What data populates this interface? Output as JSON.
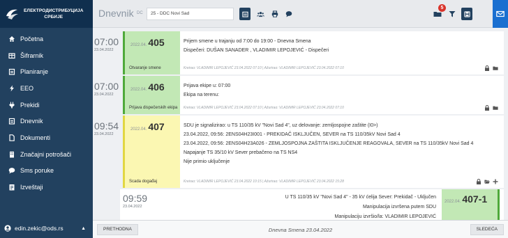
{
  "brand": {
    "line1": "ЕЛЕКТРОДИСТРИБУЦИЈА",
    "line2": "СРБИЈЕ"
  },
  "sidebar": {
    "items": [
      {
        "label": "Početna",
        "icon": "home-icon"
      },
      {
        "label": "Šifrarnik",
        "icon": "table-icon"
      },
      {
        "label": "Planiranje",
        "icon": "calendar-icon"
      },
      {
        "label": "EEO",
        "icon": "bolt-icon"
      },
      {
        "label": "Prekidi",
        "icon": "plug-icon"
      },
      {
        "label": "Dnevnik",
        "icon": "calendar-icon"
      },
      {
        "label": "Dokumenti",
        "icon": "file-icon"
      },
      {
        "label": "Značajni potrošači",
        "icon": "building-icon"
      },
      {
        "label": "Sms poruke",
        "icon": "comment-icon"
      },
      {
        "label": "Izveštaji",
        "icon": "report-icon"
      }
    ],
    "user": "edin.zekic@ods.rs"
  },
  "topbar": {
    "title": "Dnevnik",
    "sub": "DC",
    "select_value": "25 - DDC Novi Sad",
    "notification_count": "5"
  },
  "entries": [
    {
      "time": "07:00",
      "date": "23.04.2022",
      "prefix": "2022.04.",
      "number": "405",
      "label": "Otvaranje smene",
      "lines": [
        "Prijem smene u trajanju od 7:00 do 19:00 - Dnevna Smena",
        "Dispečeri: DUŠAN SANADER , VLADIMIR LEPOJEVIĆ - Dispečeri"
      ],
      "meta": "Kreirao: VLADIMIR LEPOJEVIĆ 23.04.2022 07:10 | Ažurirao: VLADIMIR LEPOJEVIĆ 23.04.2022 07:10"
    },
    {
      "time": "07:00",
      "date": "23.04.2022",
      "prefix": "2022.04.",
      "number": "406",
      "label": "Prijava dispečerskih ekipa",
      "lines": [
        "Prijava ekipe u: 07:00",
        "Ekipa na terenu:"
      ],
      "meta": "Kreirao: VLADIMIR LEPOJEVIĆ 23.04.2022 07:10 | Ažurirao: VLADIMIR LEPOJEVIĆ 23.04.2022 07:10"
    },
    {
      "time": "09:54",
      "date": "23.04.2022",
      "prefix": "2022.04.",
      "number": "407",
      "label": "Scada događaj",
      "lines": [
        "SDU je signalizirao: u TS 110/35 kV \"Novi Sad 4\", uz delovanje: zemljospojne zaštite (I0>)",
        "23.04.2022, 09:56: 2ENS04H23I001 - PREKIDAČ ISKLJUČEN, SEVER na TS 110/35kV Novi Sad 4",
        "23.04.2022, 09:56: 2ENS04H23A026 - ZEMLJOSPOJNA ZAŠTITA ISKLJUČENJE REAGOVALA, SEVER na TS 110/35kV Novi Sad 4",
        "Napajanje TS 35/10 kV Sever prebačeno na TS NS4",
        "Nije primio uključenje"
      ],
      "meta": "Kreirao: VLADIMIR LEPOJEVIĆ 23.04.2022 10:15 | Ažurirao: VLADIMIR LEPOJEVIĆ 23.04.2022 15:28"
    }
  ],
  "subentry": {
    "time": "09:59",
    "date": "23.04.2022",
    "prefix": "2022.04.",
    "number": "407-1",
    "lines": [
      "U TS 110/35 kV \"Novi Sad 4\" - 35 kV ćelija Sever: Prekidač - Uključen",
      "Manipulacija izvršena putem SDU",
      "Manipulaciju izvršio/la: VLADIMIR LEPOJEVIĆ"
    ]
  },
  "bottombar": {
    "prev": "PRETHODNA",
    "shift": "Dnevna Smena 23.04.2022",
    "next": "SLEDEĆA"
  },
  "colors": {
    "sidebar": "#22415f",
    "accent_green": "#4fa93a",
    "accent_yellow": "#e1d742",
    "badge": "#d9342b"
  }
}
